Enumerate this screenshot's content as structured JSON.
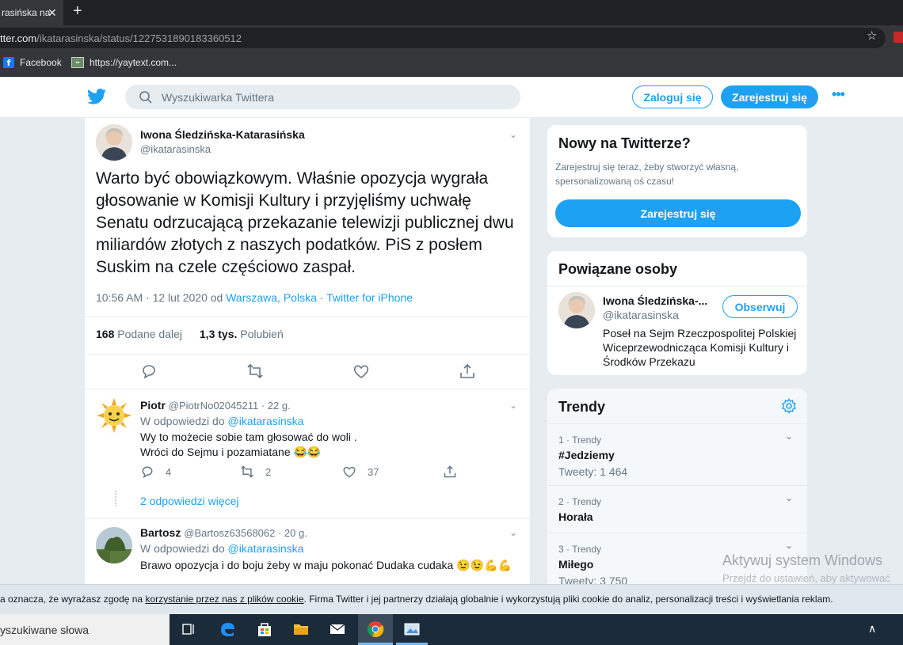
{
  "browser": {
    "tab_title": "rasińska na",
    "url_host": "tter.com",
    "url_path": "/ikatarasinska/status/1227531890183360512",
    "bookmarks": [
      {
        "label": "Facebook",
        "icon": "facebook-icon"
      },
      {
        "label": "https://yaytext.com...",
        "icon": "yaytext-icon"
      }
    ]
  },
  "header": {
    "search_placeholder": "Wyszukiwarka Twittera",
    "login_label": "Zaloguj się",
    "signup_label": "Zarejestruj się",
    "accent": "#1da1f2"
  },
  "tweet": {
    "name": "Iwona Śledzińska-Katarasińska",
    "handle": "@ikatarasinska",
    "text": "Warto być obowiązkowym. Właśnie opozycja wygrała głosowanie w Komisji Kultury i przyjęliśmy uchwałę Senatu odrzucającą przekazanie telewizji publicznej dwu miliardów złotych z naszych podatków. PiS z posłem Suskim na czele częściowo zaspał.",
    "time": "10:56 AM · 12 lut 2020 od ",
    "location": "Warszawa, Polska",
    "sep": " · ",
    "source": "Twitter for iPhone",
    "retweets": "168",
    "retweets_label": " Podane dalej",
    "likes": "1,3 tys.",
    "likes_label": " Polubień"
  },
  "replies": [
    {
      "name": "Piotr",
      "handle": "@PiotrNo02045211",
      "age": " · 22 g.",
      "in_reply_prefix": "W odpowiedzi do ",
      "in_reply_to": "@ikatarasinska",
      "line1": "Wy to możecie sobie tam głosować do woli .",
      "line2": "Wróci do Sejmu i pozamiatane 😂😂",
      "reply_count": "4",
      "retweet_count": "2",
      "like_count": "37",
      "more_replies": "2 odpowiedzi więcej"
    },
    {
      "name": "Bartosz",
      "handle": "@Bartosz63568062",
      "age": " · 20 g.",
      "in_reply_prefix": "W odpowiedzi do ",
      "in_reply_to": "@ikatarasinska",
      "line1": "Brawo opozycja i do boju żeby w maju pokonać Dudaka cudaka 😉😉💪💪"
    }
  ],
  "sidebar": {
    "new_title": "Nowy na Twitterze?",
    "new_sub": "Zarejestruj się teraz, żeby stworzyć własną, spersonalizowaną oś czasu!",
    "new_button": "Zarejestruj się",
    "related_title": "Powiązane osoby",
    "related_name": "Iwona Śledzińska-...",
    "related_handle": "@ikatarasinska",
    "related_bio": "Poseł na Sejm Rzeczpospolitej Polskiej Wiceprzewodnicząca Komisji Kultury i Środków Przekazu",
    "follow_label": "Obserwuj",
    "trends_title": "Trendy",
    "trends": [
      {
        "meta": "1 · Trendy",
        "name": "#Jedziemy",
        "count": "Tweety: 1 464"
      },
      {
        "meta": "2 · Trendy",
        "name": "Horała",
        "count": ""
      },
      {
        "meta": "3 · Trendy",
        "name": "Miłego",
        "count": "Tweety: 3 750"
      }
    ]
  },
  "watermark": {
    "title": "Aktywuj system Windows",
    "sub": "Przejdź do ustawień, aby aktywować"
  },
  "cookie": {
    "prefix": "a oznacza, że wyrażasz zgodę na ",
    "link": "korzystanie przez nas z plików cookie",
    "suffix": ". Firma Twitter i jej partnerzy działają globalnie i wykorzystują pliki cookie do analiz, personalizacji treści i wyświetlania reklam."
  },
  "taskbar": {
    "search_text": "yszukiwane słowa"
  }
}
